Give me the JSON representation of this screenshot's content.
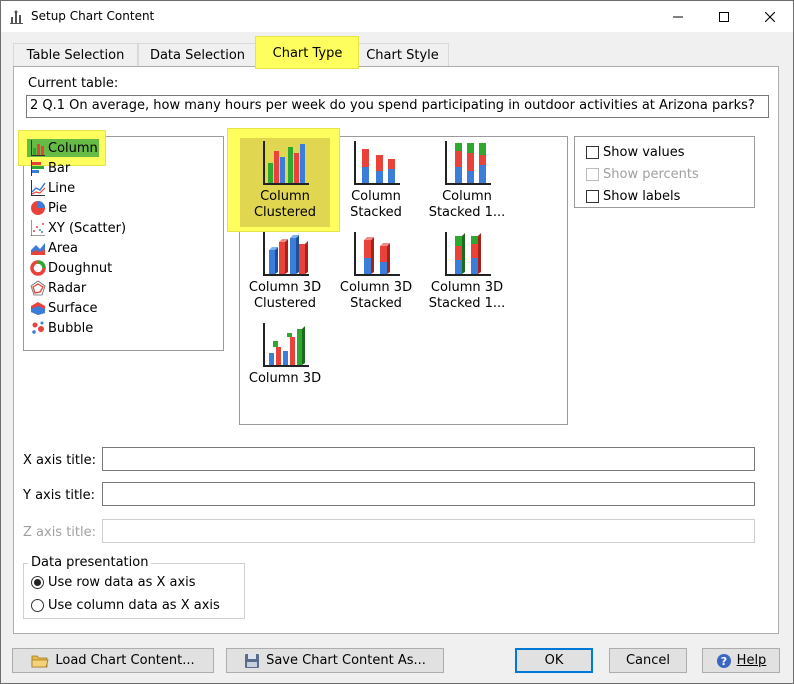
{
  "window": {
    "title": "Setup Chart Content"
  },
  "tabs": [
    {
      "label": "Table Selection"
    },
    {
      "label": "Data Selection"
    },
    {
      "label": "Chart Type"
    },
    {
      "label": "Chart Style"
    }
  ],
  "current_table": {
    "label": "Current table:",
    "value": "2 Q.1 On average, how many hours per week do you spend participating in outdoor activities at Arizona parks?"
  },
  "chart_types": [
    {
      "label": "Column",
      "icon": "column-chart-icon"
    },
    {
      "label": "Bar",
      "icon": "bar-chart-icon"
    },
    {
      "label": "Line",
      "icon": "line-chart-icon"
    },
    {
      "label": "Pie",
      "icon": "pie-chart-icon"
    },
    {
      "label": "XY (Scatter)",
      "icon": "scatter-chart-icon"
    },
    {
      "label": "Area",
      "icon": "area-chart-icon"
    },
    {
      "label": "Doughnut",
      "icon": "doughnut-chart-icon"
    },
    {
      "label": "Radar",
      "icon": "radar-chart-icon"
    },
    {
      "label": "Surface",
      "icon": "surface-chart-icon"
    },
    {
      "label": "Bubble",
      "icon": "bubble-chart-icon"
    }
  ],
  "subtypes": [
    {
      "line1": "Column",
      "line2": "Clustered"
    },
    {
      "line1": "Column",
      "line2": "Stacked"
    },
    {
      "line1": "Column",
      "line2": "Stacked 1..."
    },
    {
      "line1": "Column 3D",
      "line2": "Clustered"
    },
    {
      "line1": "Column 3D",
      "line2": "Stacked"
    },
    {
      "line1": "Column 3D",
      "line2": "Stacked 1..."
    },
    {
      "line1": "Column 3D",
      "line2": ""
    }
  ],
  "options": {
    "show_values": "Show values",
    "show_percents": "Show percents",
    "show_labels": "Show labels"
  },
  "axis": {
    "x_label": "X axis title:",
    "y_label": "Y axis title:",
    "z_label": "Z axis title:",
    "x_value": "",
    "y_value": "",
    "z_value": ""
  },
  "data_presentation": {
    "title": "Data presentation",
    "row": "Use row data as X axis",
    "column": "Use column data as X axis"
  },
  "buttons": {
    "load": "Load Chart Content...",
    "save": "Save Chart Content As...",
    "ok": "OK",
    "cancel": "Cancel",
    "help": "Help"
  },
  "colors": {
    "highlight": "#fefe5e",
    "selection_green": "#66bb44",
    "series_red": "#e8423a",
    "series_green": "#2ea82e",
    "series_blue": "#3b7dd8",
    "focus_blue": "#0078d7"
  }
}
